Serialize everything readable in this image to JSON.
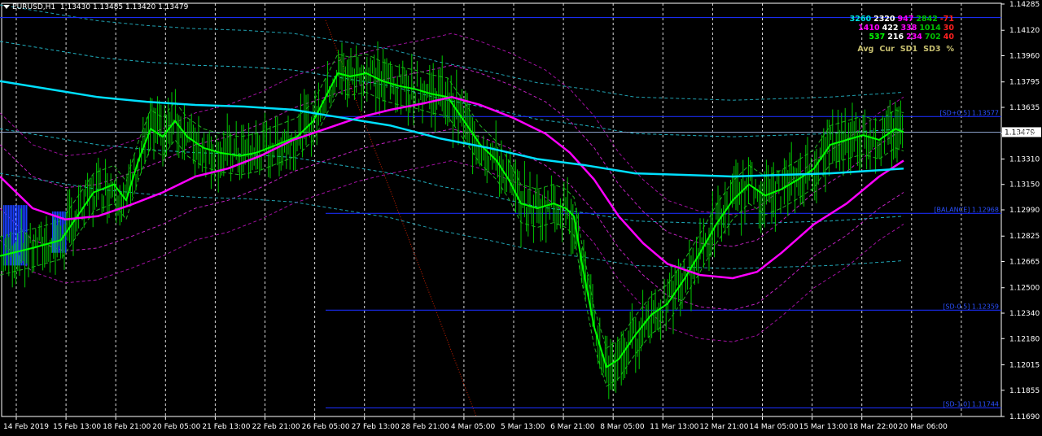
{
  "header": {
    "symbol": "EURUSD,H1",
    "ohlc": "1.13430 1.13485 1.13420 1.13479"
  },
  "stats": {
    "rows": [
      {
        "values": [
          "3260",
          "2320",
          "947",
          "2842",
          "-71"
        ],
        "colors": [
          "#00e0e0",
          "#ffffff",
          "#ff00ff",
          "#00c000",
          "#ff2020"
        ]
      },
      {
        "values": [
          "1410",
          "422",
          "338",
          "1014",
          "30"
        ],
        "colors": [
          "#ff00ff",
          "#ffffff",
          "#ff00ff",
          "#00c000",
          "#ff2020"
        ]
      },
      {
        "values": [
          "537",
          "216",
          "234",
          "702",
          "40"
        ],
        "colors": [
          "#00ff00",
          "#ffffff",
          "#ff00ff",
          "#00c000",
          "#ff2020"
        ]
      }
    ],
    "labels": [
      "Avg",
      "Cur",
      "SD1",
      "SD3",
      "%"
    ]
  },
  "chart_data": {
    "type": "line",
    "symbol": "EURUSD",
    "timeframe": "H1",
    "ylim": [
      1.1169,
      1.1429
    ],
    "grid": true,
    "y_ticks": [
      "1.14285",
      "1.14120",
      "1.13960",
      "1.13795",
      "1.13635",
      "1.13470",
      "1.13310",
      "1.13150",
      "1.12990",
      "1.12825",
      "1.12665",
      "1.12500",
      "1.12340",
      "1.12180",
      "1.12015",
      "1.11855",
      "1.11690"
    ],
    "x_ticks": [
      "14 Feb 2019",
      "15 Feb 13:00",
      "18 Feb 21:00",
      "20 Feb 05:00",
      "21 Feb 13:00",
      "22 Feb 21:00",
      "26 Feb 05:00",
      "27 Feb 13:00",
      "28 Feb 21:00",
      "4 Mar 05:00",
      "5 Mar 13:00",
      "6 Mar 21:00",
      "8 Mar 05:00",
      "11 Mar 13:00",
      "12 Mar 21:00",
      "14 Mar 05:00",
      "15 Mar 13:00",
      "18 Mar 22:00",
      "20 Mar 06:00"
    ],
    "current_price": {
      "label": "1.13479",
      "value": 1.13479
    },
    "levels": [
      {
        "label": "",
        "value": 1.142
      },
      {
        "label": "[SD+0.5] 1.13577",
        "value": 1.13577
      },
      {
        "label": "[BALANCE] 1.12968",
        "value": 1.12968
      },
      {
        "label": "[SD-0.5] 1.12359",
        "value": 1.12359
      },
      {
        "label": "[SD-1.0] 1.11744",
        "value": 1.11744
      }
    ],
    "series": [
      {
        "color": "#00ff00",
        "values": [
          [
            0,
            1.127
          ],
          [
            40,
            1.1275
          ],
          [
            75,
            1.128
          ],
          [
            95,
            1.1295
          ],
          [
            115,
            1.131
          ],
          [
            140,
            1.1315
          ],
          [
            155,
            1.1305
          ],
          [
            170,
            1.133
          ],
          [
            185,
            1.135
          ],
          [
            200,
            1.1345
          ],
          [
            215,
            1.1355
          ],
          [
            230,
            1.1345
          ],
          [
            250,
            1.1338
          ],
          [
            270,
            1.1335
          ],
          [
            295,
            1.1333
          ],
          [
            315,
            1.1335
          ],
          [
            340,
            1.134
          ],
          [
            365,
            1.1345
          ],
          [
            385,
            1.1355
          ],
          [
            400,
            1.137
          ],
          [
            415,
            1.1385
          ],
          [
            430,
            1.1383
          ],
          [
            450,
            1.1385
          ],
          [
            470,
            1.138
          ],
          [
            490,
            1.1377
          ],
          [
            510,
            1.1375
          ],
          [
            530,
            1.1372
          ],
          [
            550,
            1.137
          ],
          [
            570,
            1.1355
          ],
          [
            590,
            1.134
          ],
          [
            610,
            1.133
          ],
          [
            625,
            1.1318
          ],
          [
            640,
            1.1303
          ],
          [
            660,
            1.13
          ],
          [
            680,
            1.1303
          ],
          [
            695,
            1.13
          ],
          [
            705,
            1.1295
          ],
          [
            715,
            1.1265
          ],
          [
            730,
            1.1225
          ],
          [
            745,
            1.12
          ],
          [
            760,
            1.1205
          ],
          [
            780,
            1.122
          ],
          [
            800,
            1.1233
          ],
          [
            820,
            1.124
          ],
          [
            840,
            1.1255
          ],
          [
            860,
            1.1272
          ],
          [
            880,
            1.129
          ],
          [
            900,
            1.1305
          ],
          [
            920,
            1.1315
          ],
          [
            940,
            1.1308
          ],
          [
            960,
            1.1312
          ],
          [
            980,
            1.1318
          ],
          [
            1000,
            1.1325
          ],
          [
            1020,
            1.134
          ],
          [
            1040,
            1.1343
          ],
          [
            1060,
            1.1346
          ],
          [
            1080,
            1.1343
          ],
          [
            1100,
            1.135
          ],
          [
            1110,
            1.1348
          ]
        ]
      },
      {
        "color": "#ff00ff",
        "values": [
          [
            0,
            1.132
          ],
          [
            40,
            1.13
          ],
          [
            80,
            1.1293
          ],
          [
            120,
            1.1295
          ],
          [
            160,
            1.1302
          ],
          [
            200,
            1.131
          ],
          [
            240,
            1.132
          ],
          [
            280,
            1.1325
          ],
          [
            320,
            1.1333
          ],
          [
            360,
            1.1343
          ],
          [
            400,
            1.135
          ],
          [
            440,
            1.1357
          ],
          [
            480,
            1.1362
          ],
          [
            520,
            1.1366
          ],
          [
            555,
            1.137
          ],
          [
            590,
            1.1365
          ],
          [
            630,
            1.1357
          ],
          [
            670,
            1.1347
          ],
          [
            700,
            1.1335
          ],
          [
            730,
            1.1318
          ],
          [
            760,
            1.1295
          ],
          [
            790,
            1.1278
          ],
          [
            820,
            1.1265
          ],
          [
            860,
            1.1258
          ],
          [
            900,
            1.1256
          ],
          [
            930,
            1.126
          ],
          [
            960,
            1.1272
          ],
          [
            1000,
            1.129
          ],
          [
            1040,
            1.1303
          ],
          [
            1080,
            1.132
          ],
          [
            1110,
            1.133
          ]
        ]
      },
      {
        "color": "#00e0ff",
        "values": [
          [
            0,
            1.138
          ],
          [
            60,
            1.1375
          ],
          [
            120,
            1.137
          ],
          [
            180,
            1.1367
          ],
          [
            240,
            1.1365
          ],
          [
            300,
            1.1364
          ],
          [
            360,
            1.1362
          ],
          [
            420,
            1.1357
          ],
          [
            480,
            1.1352
          ],
          [
            540,
            1.1344
          ],
          [
            600,
            1.1338
          ],
          [
            660,
            1.1331
          ],
          [
            720,
            1.1327
          ],
          [
            780,
            1.1322
          ],
          [
            840,
            1.1321
          ],
          [
            900,
            1.132
          ],
          [
            960,
            1.1321
          ],
          [
            1020,
            1.1322
          ],
          [
            1080,
            1.1324
          ],
          [
            1110,
            1.1325
          ]
        ]
      }
    ]
  }
}
